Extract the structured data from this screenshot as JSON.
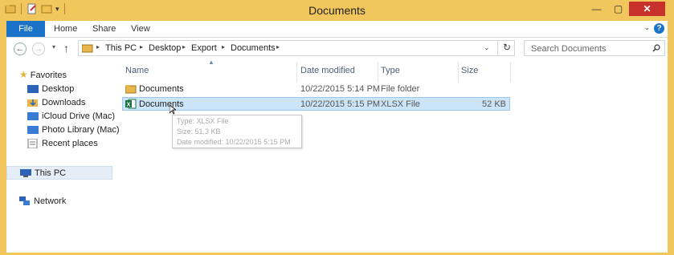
{
  "window": {
    "title": "Documents",
    "controls": {
      "minimize": "—",
      "maximize": "▢",
      "close": "✕"
    }
  },
  "ribbon": {
    "tabs": [
      "File",
      "Home",
      "Share",
      "View"
    ],
    "help": "?"
  },
  "address": {
    "crumbs": [
      "This PC",
      "Desktop",
      "Export",
      "Documents"
    ]
  },
  "search": {
    "placeholder": "Search Documents"
  },
  "nav": {
    "favorites_label": "Favorites",
    "favorites": [
      "Desktop",
      "Downloads",
      "iCloud Drive (Mac)",
      "Photo Library (Mac)",
      "Recent places"
    ],
    "this_pc": "This PC",
    "network": "Network"
  },
  "columns": [
    "Name",
    "Date modified",
    "Type",
    "Size"
  ],
  "files": [
    {
      "name": "Documents",
      "date": "10/22/2015 5:14 PM",
      "type": "File folder",
      "size": "",
      "icon": "folder-icon"
    },
    {
      "name": "Documents",
      "date": "10/22/2015 5:15 PM",
      "type": "XLSX File",
      "size": "52 KB",
      "icon": "excel-icon"
    }
  ],
  "tooltip": {
    "type": "Type: XLSX File",
    "size": "Size: 51.3 KB",
    "date": "Date modified: 10/22/2015 5:15 PM"
  },
  "colors": {
    "title_bar": "#f1c75d",
    "accent": "#1a73c8",
    "close": "#c7302b",
    "selection": "#cce4f7"
  }
}
